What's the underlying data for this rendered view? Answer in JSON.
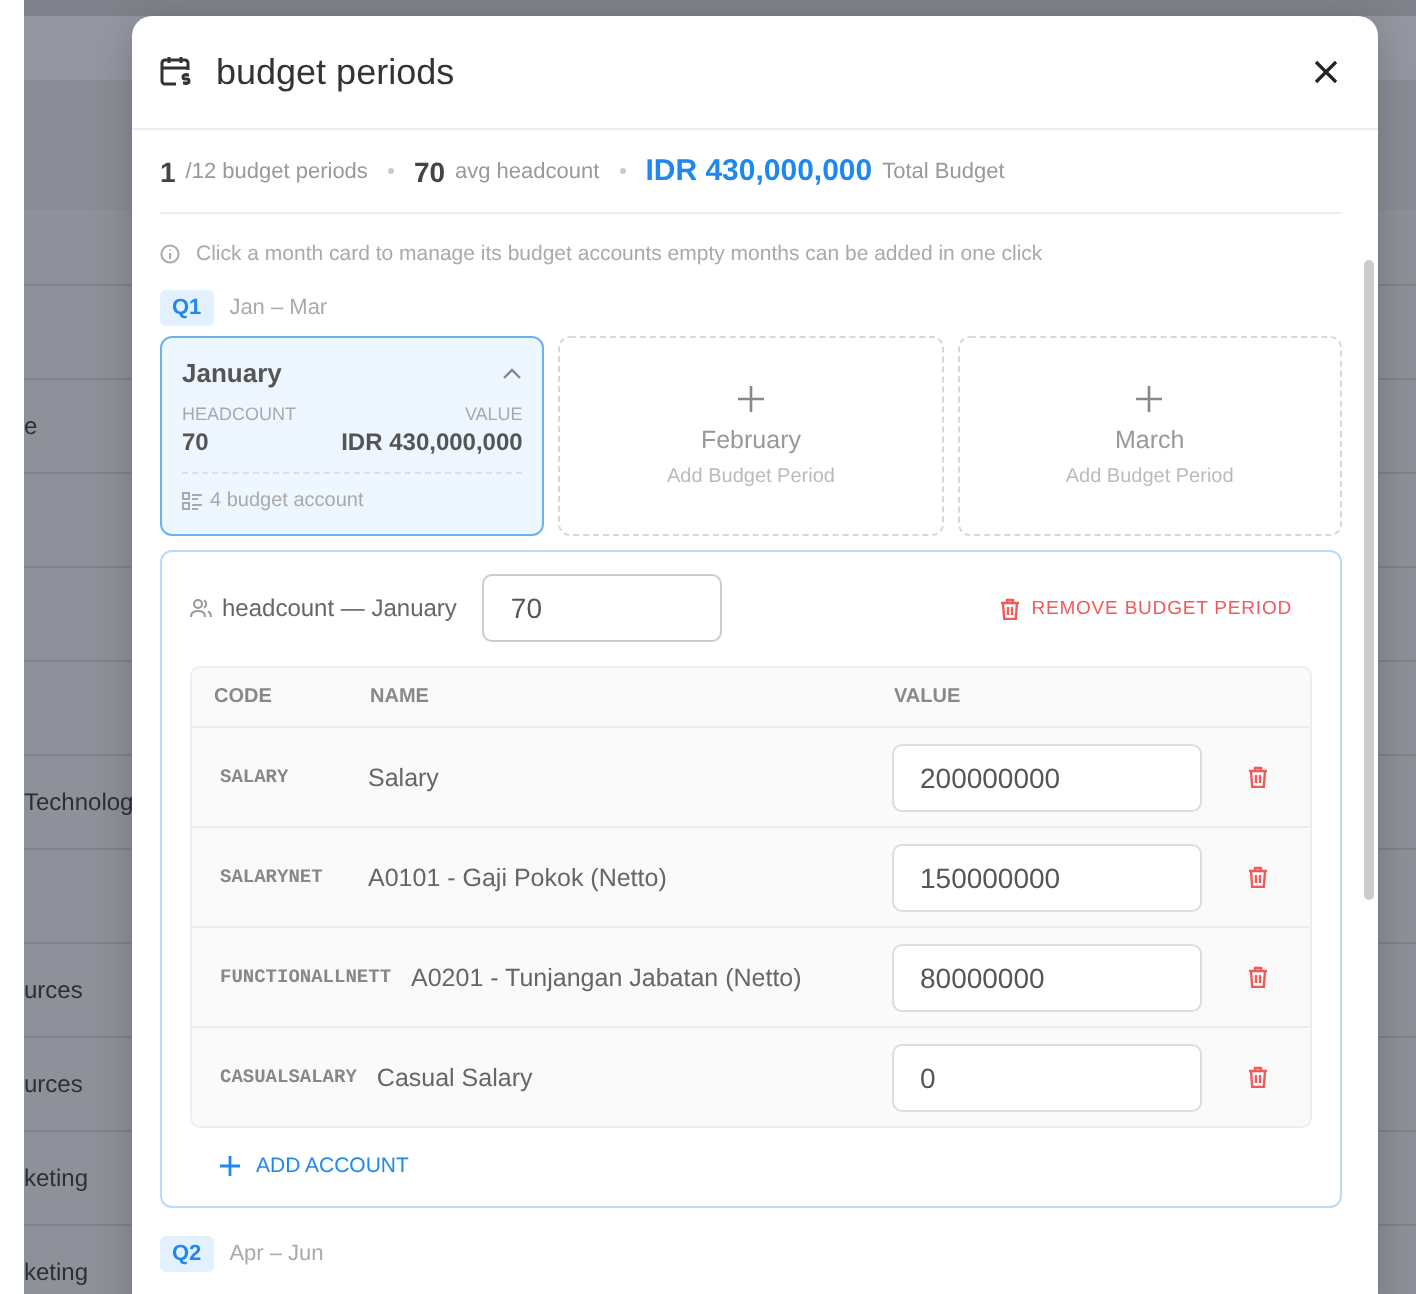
{
  "background_list": {
    "rows": [
      {},
      {
        "label": "e"
      },
      {},
      {},
      {},
      {
        "label": "Technolog"
      },
      {},
      {
        "label": "urces"
      },
      {
        "label": "urces"
      },
      {
        "label": "keting"
      },
      {
        "label": "keting"
      }
    ]
  },
  "dialog": {
    "title": "budget periods",
    "summary": {
      "count": "1",
      "count_label": "/12 budget periods",
      "headcount": "70",
      "headcount_label": "avg headcount",
      "total": "IDR 430,000,000",
      "total_label": "Total Budget"
    },
    "hint": "Click a month card to manage its budget accounts empty months can be added in one click",
    "quarters": [
      {
        "badge": "Q1",
        "range": "Jan – Mar",
        "months": [
          {
            "kind": "filled",
            "name": "January",
            "selected": true,
            "expanded": true,
            "headcount_label": "HEADCOUNT",
            "headcount": "70",
            "value_label": "VALUE",
            "value": "IDR 430,000,000",
            "accounts": "4 budget account"
          },
          {
            "kind": "empty",
            "name": "February",
            "action": "Add Budget Period"
          },
          {
            "kind": "empty",
            "name": "March",
            "action": "Add Budget Period"
          }
        ],
        "detail": {
          "headcount_label": "headcount — January",
          "headcount": "70",
          "remove": "REMOVE BUDGET PERIOD",
          "columns": [
            "CODE",
            "NAME",
            "VALUE"
          ],
          "rows": [
            {
              "code": "SALARY",
              "name": "Salary",
              "value": "200000000"
            },
            {
              "code": "SALARYNET",
              "name": "A0101 - Gaji Pokok (Netto)",
              "value": "150000000"
            },
            {
              "code": "FUNCTIONALLNETT",
              "name": "A0201 - Tunjangan Jabatan (Netto)",
              "value": "80000000"
            },
            {
              "code": "CASUALSALARY",
              "name": "Casual Salary",
              "value": "0"
            }
          ],
          "add": "ADD ACCOUNT"
        }
      },
      {
        "badge": "Q2",
        "range": "Apr – Jun"
      }
    ]
  }
}
